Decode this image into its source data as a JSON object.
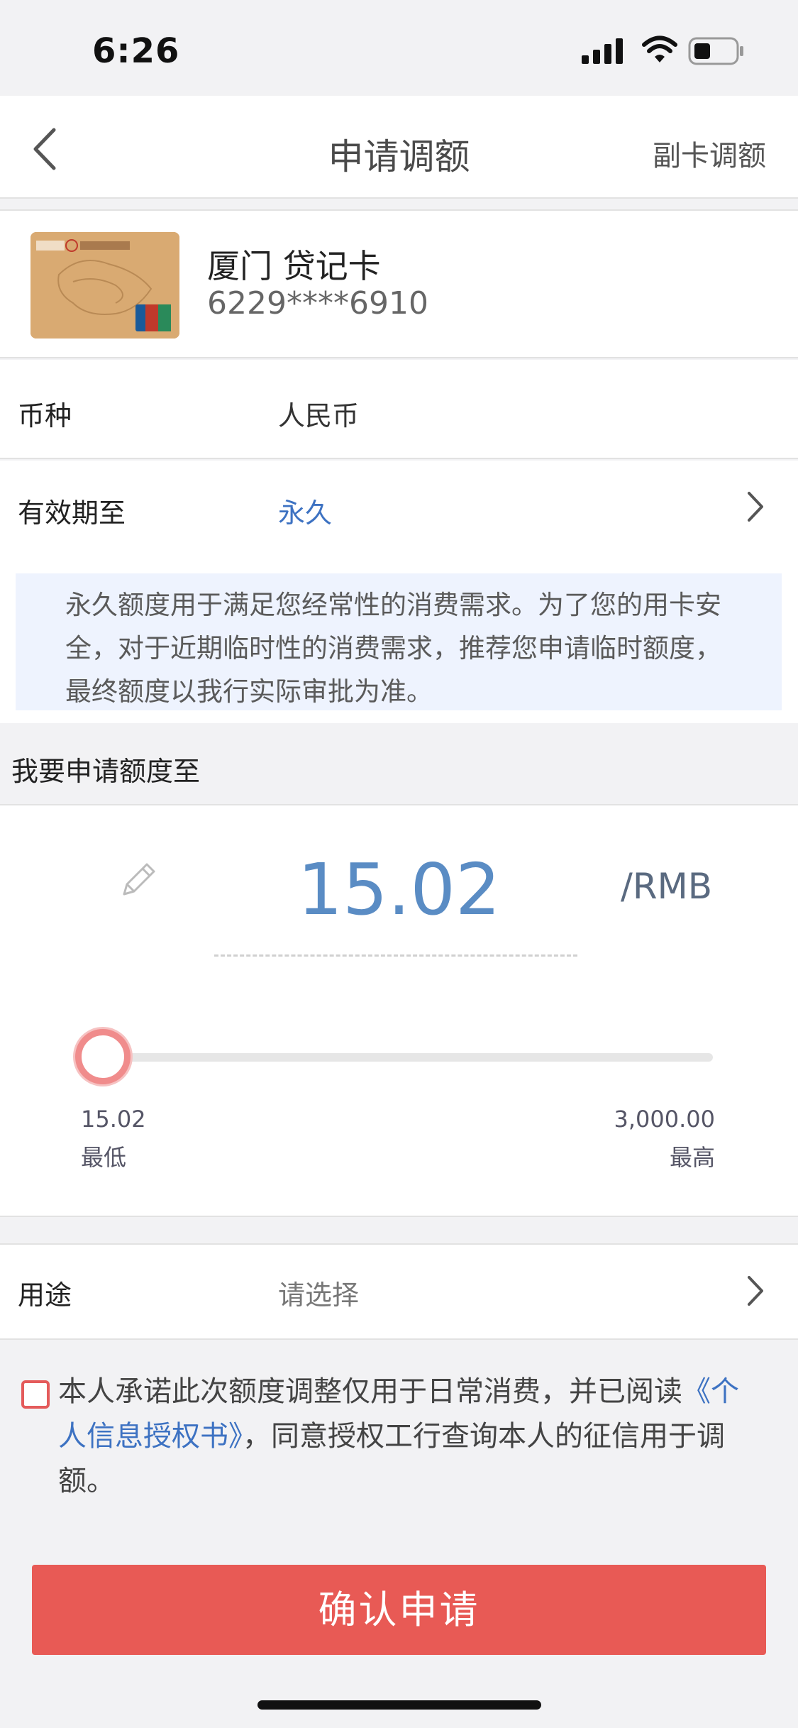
{
  "status_bar": {
    "time": "6:26"
  },
  "nav": {
    "title": "申请调额",
    "right_action": "副卡调额"
  },
  "card": {
    "name": "厦门 贷记卡",
    "number": "6229****6910"
  },
  "currency": {
    "label": "币种",
    "value": "人民币"
  },
  "expiry": {
    "label": "有效期至",
    "value": "永久"
  },
  "notice": {
    "text": "永久额度用于满足您经常性的消费需求。为了您的用卡安全，对于近期临时性的消费需求，推荐您申请临时额度，最终额度以我行实际审批为准。"
  },
  "amount_section": {
    "title": "我要申请额度至",
    "value": "15.02",
    "unit": "/RMB",
    "slider_level_fraction": 0.0,
    "min_value": "15.02",
    "min_label": "最低",
    "max_value": "3,000.00",
    "max_label": "最高"
  },
  "purpose": {
    "label": "用途",
    "placeholder": "请选择"
  },
  "agreement": {
    "prefix": "本人承诺此次额度调整仅用于日常消费，并已阅读",
    "link": "《个人信息授权书》",
    "suffix": "，同意授权工行查询本人的征信用于调额。"
  },
  "confirm_button": "确认申请",
  "colors": {
    "accent_blue": "#5a8cc4",
    "link_blue": "#3d72c2",
    "confirm_red": "#e85a55",
    "notice_bg": "#eef3fe"
  },
  "icons": [
    "signal-icon",
    "wifi-icon",
    "battery-icon",
    "back-arrow-icon",
    "chevron-right-icon",
    "pencil-icon",
    "checkbox-icon"
  ]
}
